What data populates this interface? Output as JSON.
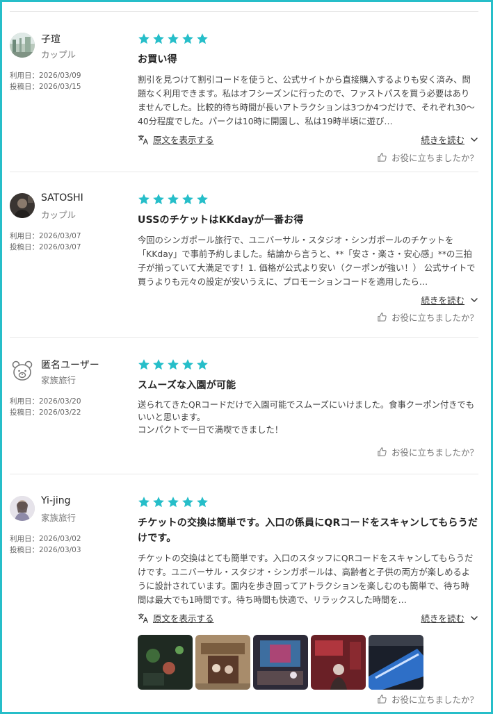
{
  "reviews": [
    {
      "user": "子瑄",
      "type": "カップル",
      "used": "利用日：2026/03/09",
      "posted": "投稿日：2026/03/15",
      "title": "お買い得",
      "body": "割引を見つけて割引コードを使うと、公式サイトから直接購入するよりも安く済み、問題なく利用できます。私はオフシーズンに行ったので、ファストパスを買う必要はありませんでした。比較的待ち時間が長いアトラクションは3つか4つだけで、それぞれ30〜40分程度でした。パークは10時に開園し、私は19時半頃に遊び…",
      "show_original": "原文を表示する",
      "read_more": "続きを読む",
      "helpful": "お役に立ちましたか？"
    },
    {
      "user": "SATOSHI",
      "type": "カップル",
      "used": "利用日：2026/03/07",
      "posted": "投稿日：2026/03/07",
      "title": "USSのチケットはKKdayが一番お得",
      "body": "今回のシンガポール旅行で、ユニバーサル・スタジオ・シンガポールのチケットを「KKday」で事前予約しました。結論から言うと、**「安さ・楽さ・安心感」**の三拍子が揃っていて大満足です！1. 価格が公式より安い（クーポンが強い！） 公式サイトで買うよりも元々の設定が安いうえに、プロモーションコードを適用したら…",
      "read_more": "続きを読む",
      "helpful": "お役に立ちましたか？"
    },
    {
      "user": "匿名ユーザー",
      "type": "家族旅行",
      "used": "利用日：2026/03/20",
      "posted": "投稿日：2026/03/22",
      "title": "スムーズな入園が可能",
      "body": "送られてきたQRコードだけで入園可能でスムーズにいけました。食事クーポン付きでもいいと思います。\nコンパクトで一日で満喫できました！",
      "helpful": "お役に立ちましたか？"
    },
    {
      "user": "Yi-jing",
      "type": "家族旅行",
      "used": "利用日：2026/03/02",
      "posted": "投稿日：2026/03/03",
      "title": "チケットの交換は簡単です。入口の係員にQRコードをスキャンしてもらうだけです。",
      "body": "チケットの交換はとても簡単です。入口のスタッフにQRコードをスキャンしてもらうだけです。ユニバーサル・スタジオ・シンガポールは、高齢者と子供の両方が楽しめるように設計されています。園内を歩き回ってアトラクションを楽しむのも簡単で、待ち時間は最大でも1時間です。待ち時間も快適で、リラックスした時間を…",
      "show_original": "原文を表示する",
      "read_more": "続きを読む",
      "helpful": "お役に立ちましたか？",
      "photo_count": 5
    }
  ],
  "colors": {
    "star": "#26bec9",
    "border": "#26bec9",
    "divider": "#e8e8e8"
  },
  "icons": {
    "star": "star-icon",
    "translate": "translate-icon",
    "chevron": "chevron-down-icon",
    "thumbs_up": "thumbs-up-icon"
  }
}
